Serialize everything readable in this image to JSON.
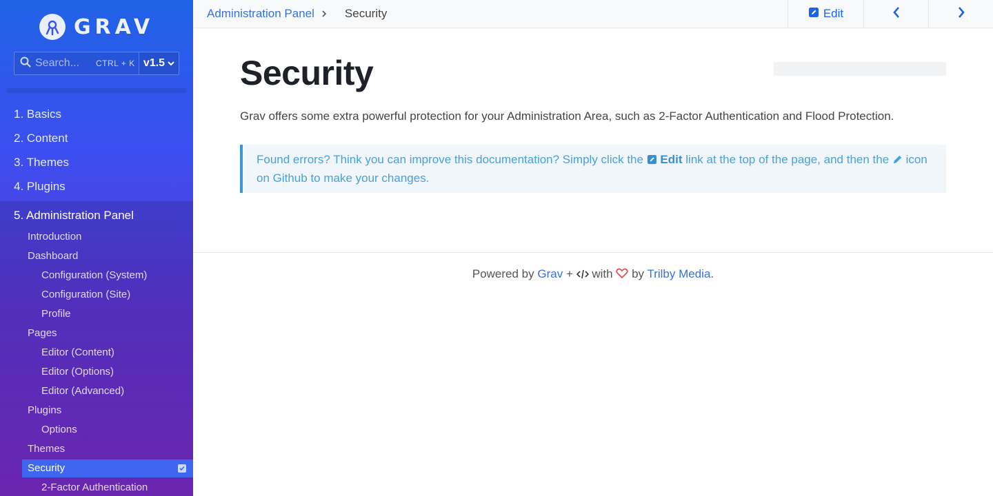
{
  "sidebar": {
    "brand": "GRAV",
    "search": {
      "placeholder": "Search...",
      "shortcut": "CTRL + K"
    },
    "version": "v1.5",
    "top_items": [
      {
        "label": "1. Basics"
      },
      {
        "label": "2. Content"
      },
      {
        "label": "3. Themes"
      },
      {
        "label": "4. Plugins"
      }
    ],
    "active_section": {
      "label": "5. Administration Panel",
      "children": [
        {
          "label": "Introduction"
        },
        {
          "label": "Dashboard"
        },
        {
          "label": "Configuration (System)"
        },
        {
          "label": "Configuration (Site)"
        },
        {
          "label": "Profile"
        },
        {
          "label": "Pages"
        },
        {
          "label": "Editor (Content)"
        },
        {
          "label": "Editor (Options)"
        },
        {
          "label": "Editor (Advanced)"
        },
        {
          "label": "Plugins"
        },
        {
          "label": "Options"
        },
        {
          "label": "Themes"
        },
        {
          "label": "Security"
        },
        {
          "label": "2-Factor Authentication"
        }
      ]
    }
  },
  "topbar": {
    "breadcrumb_parent": "Administration Panel",
    "breadcrumb_current": "Security",
    "edit_label": "Edit"
  },
  "main": {
    "title": "Security",
    "intro": "Grav offers some extra powerful protection for your Administration Area, such as 2-Factor Authentication and Flood Protection.",
    "notice": {
      "part1": "Found errors? Think you can improve this documentation? Simply click the",
      "edit": "Edit",
      "part2": "link at the top of the page, and then the",
      "part3": "icon on Github to make your changes."
    }
  },
  "footer": {
    "powered_by": "Powered by",
    "grav_link": "Grav",
    "plus": "+",
    "with": "with",
    "by": "by",
    "trilby_link": "Trilby Media",
    "period": "."
  },
  "colors": {
    "accent": "#1f63e6",
    "link": "#3771d8",
    "notice_border": "#3896d6",
    "heart": "#d9534f"
  }
}
